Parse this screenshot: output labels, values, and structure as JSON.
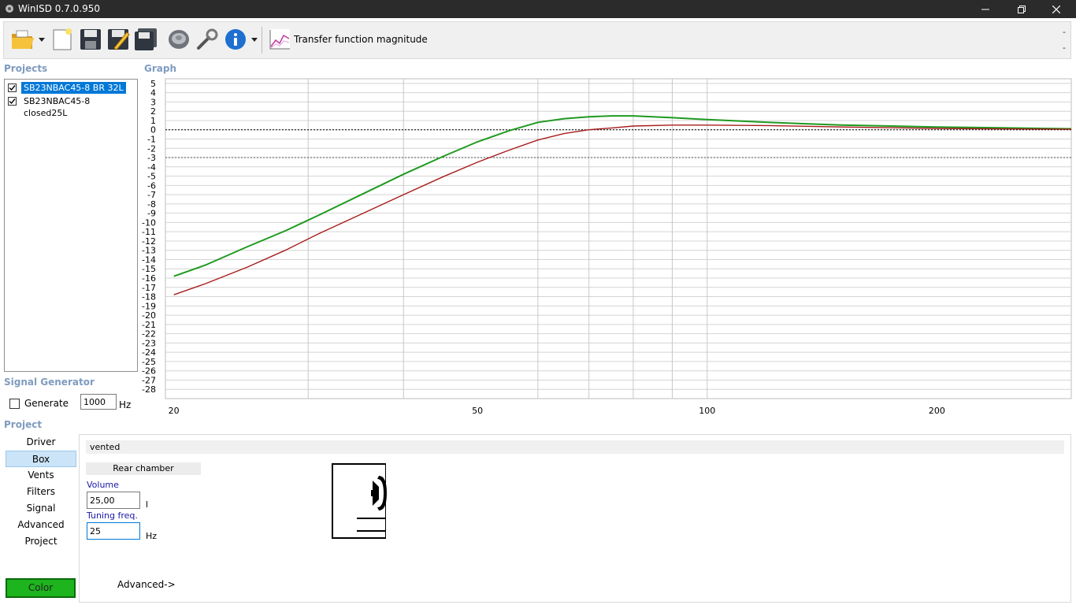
{
  "window": {
    "title": "WinISD 0.7.0.950",
    "minimize_icon": "minimize-icon",
    "restore_icon": "restore-icon",
    "close_icon": "close-icon"
  },
  "toolbar": {
    "buttons": [
      {
        "name": "open-folder",
        "icon": "folder-open-icon"
      },
      {
        "name": "new-project",
        "icon": "new-document-icon"
      },
      {
        "name": "save",
        "icon": "floppy-disk-icon"
      },
      {
        "name": "save-as",
        "icon": "floppy-edit-icon"
      },
      {
        "name": "save-all",
        "icon": "floppy-multi-icon"
      },
      {
        "name": "driver-editor",
        "icon": "speaker-icon"
      },
      {
        "name": "tools",
        "icon": "wrench-icon"
      },
      {
        "name": "info",
        "icon": "info-icon"
      }
    ],
    "graph_type_label": "Transfer function magnitude",
    "right_top": "-",
    "right_bottom": "-"
  },
  "projects": {
    "label": "Projects",
    "items": [
      {
        "label": "SB23NBAC45-8 BR 32L",
        "checked": true,
        "selected": true
      },
      {
        "label": "SB23NBAC45-8 closed25L",
        "checked": true,
        "selected": false
      }
    ]
  },
  "graph": {
    "label": "Graph"
  },
  "signal_generator": {
    "label": "Signal Generator",
    "generate_label": "Generate",
    "generate_checked": false,
    "frequency_value": "1000",
    "frequency_unit": "Hz"
  },
  "project_nav": {
    "label": "Project",
    "items": [
      "Driver",
      "Box",
      "Vents",
      "Filters",
      "Signal",
      "Advanced",
      "Project"
    ],
    "selected": "Box",
    "color_label": "Color",
    "color_value": "#1db41d"
  },
  "box_panel": {
    "box_type": "vented",
    "rear_chamber_label": "Rear chamber",
    "volume_label": "Volume",
    "volume_value": "25,00",
    "volume_unit": "l",
    "tuning_label": "Tuning freq.",
    "tuning_value": "25",
    "tuning_unit": "Hz",
    "advanced_label": "Advanced->"
  },
  "chart_data": {
    "type": "line",
    "x_scale": "log",
    "xlim": [
      19.5,
      300
    ],
    "ylim": [
      -29,
      5.5
    ],
    "x_tick_labels": [
      {
        "value": 20,
        "label": "20"
      },
      {
        "value": 50,
        "label": "50"
      },
      {
        "value": 100,
        "label": "100"
      },
      {
        "value": 200,
        "label": "200"
      }
    ],
    "x_gridlines": [
      30,
      40,
      60,
      70,
      80,
      90,
      100
    ],
    "y_ticks": [
      5,
      4,
      3,
      2,
      1,
      0,
      -1,
      -2,
      -3,
      -4,
      -5,
      -6,
      -7,
      -8,
      -9,
      -10,
      -11,
      -12,
      -13,
      -14,
      -15,
      -16,
      -17,
      -18,
      -19,
      -20,
      -21,
      -22,
      -23,
      -24,
      -25,
      -26,
      -27,
      -28
    ],
    "reference_lines": [
      0,
      -3
    ],
    "grid": true,
    "series": [
      {
        "color": "#1f9a1f",
        "points": [
          [
            20,
            -15.8
          ],
          [
            22,
            -14.6
          ],
          [
            25,
            -12.6
          ],
          [
            28,
            -10.9
          ],
          [
            31,
            -9.2
          ],
          [
            35,
            -7.1
          ],
          [
            40,
            -4.8
          ],
          [
            45,
            -2.9
          ],
          [
            50,
            -1.3
          ],
          [
            55,
            -0.1
          ],
          [
            60,
            0.8
          ],
          [
            65,
            1.2
          ],
          [
            70,
            1.4
          ],
          [
            75,
            1.5
          ],
          [
            80,
            1.5
          ],
          [
            90,
            1.3
          ],
          [
            100,
            1.1
          ],
          [
            120,
            0.8
          ],
          [
            150,
            0.5
          ],
          [
            200,
            0.3
          ],
          [
            300,
            0.1
          ]
        ]
      },
      {
        "color": "#a81c1c",
        "points": [
          [
            20,
            -17.8
          ],
          [
            22,
            -16.6
          ],
          [
            25,
            -14.8
          ],
          [
            28,
            -13.0
          ],
          [
            31,
            -11.2
          ],
          [
            35,
            -9.2
          ],
          [
            40,
            -7.0
          ],
          [
            45,
            -5.1
          ],
          [
            50,
            -3.5
          ],
          [
            55,
            -2.2
          ],
          [
            60,
            -1.1
          ],
          [
            65,
            -0.4
          ],
          [
            70,
            0.0
          ],
          [
            75,
            0.2
          ],
          [
            80,
            0.4
          ],
          [
            90,
            0.5
          ],
          [
            100,
            0.5
          ],
          [
            120,
            0.45
          ],
          [
            150,
            0.3
          ],
          [
            200,
            0.15
          ],
          [
            300,
            0.05
          ]
        ]
      }
    ]
  }
}
